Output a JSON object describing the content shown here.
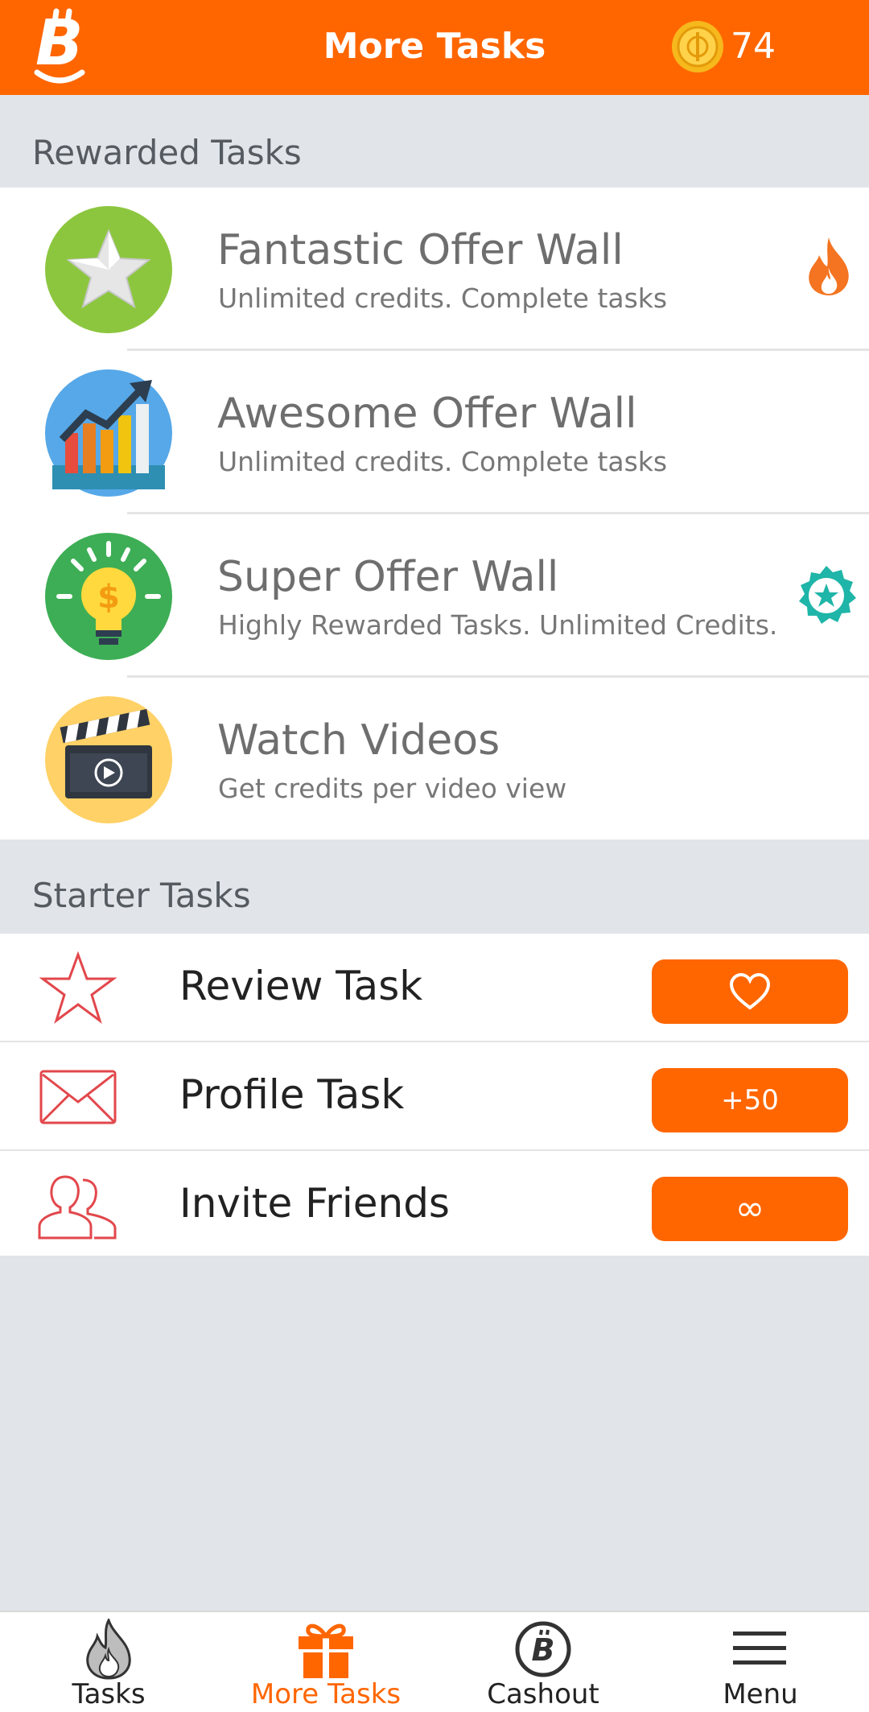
{
  "header": {
    "title": "More Tasks",
    "coin_count": "74",
    "background_color": "#ff6600"
  },
  "sections": {
    "rewarded_title": "Rewarded Tasks",
    "starter_title": "Starter Tasks"
  },
  "offers": [
    {
      "name": "Fantastic Offer Wall",
      "desc": "Unlimited credits. Complete tasks",
      "icon": "star-icon",
      "badge": "fire-icon"
    },
    {
      "name": "Awesome Offer Wall",
      "desc": "Unlimited credits. Complete tasks",
      "icon": "chart-icon",
      "badge": ""
    },
    {
      "name": "Super Offer Wall",
      "desc": "Highly Rewarded Tasks. Unlimited Credits.",
      "icon": "lightbulb-icon",
      "badge": "star-badge-icon"
    },
    {
      "name": "Watch Videos",
      "desc": "Get credits per video view",
      "icon": "clapperboard-icon",
      "badge": ""
    }
  ],
  "starter_tasks": [
    {
      "name": "Review Task",
      "icon": "star-outline-icon",
      "button": "heart-icon"
    },
    {
      "name": "Profile Task",
      "icon": "envelope-icon",
      "button": "+50"
    },
    {
      "name": "Invite Friends",
      "icon": "users-icon",
      "button": "∞"
    }
  ],
  "nav": [
    {
      "label": "Tasks",
      "icon": "fire-icon",
      "active": false
    },
    {
      "label": "More Tasks",
      "icon": "gift-icon",
      "active": true
    },
    {
      "label": "Cashout",
      "icon": "bitcoin-icon",
      "active": false
    },
    {
      "label": "Menu",
      "icon": "hamburger-icon",
      "active": false
    }
  ],
  "colors": {
    "accent": "#ff6600",
    "background": "#e1e5e9",
    "icon_red": "#e2474b",
    "badge_teal": "#1fb5a8"
  }
}
